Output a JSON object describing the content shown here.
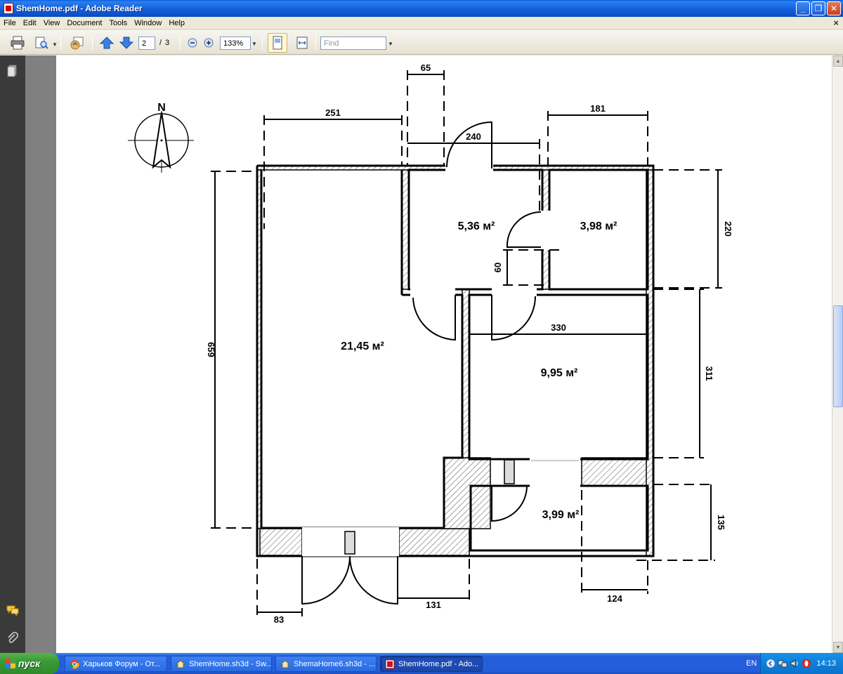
{
  "window": {
    "title": "ShemHome.pdf - Adobe Reader"
  },
  "menu": [
    "File",
    "Edit",
    "View",
    "Document",
    "Tools",
    "Window",
    "Help"
  ],
  "toolbar": {
    "current_page": "2",
    "page_separator": "/",
    "total_pages": "3",
    "zoom": "133%",
    "find_placeholder": "Find"
  },
  "floorplan": {
    "north_label": "N",
    "rooms": [
      {
        "id": "living",
        "area": "21,45 м²"
      },
      {
        "id": "small-a",
        "area": "5,36 м²"
      },
      {
        "id": "small-b",
        "area": "3,98 м²"
      },
      {
        "id": "bedroom",
        "area": "9,95 м²"
      },
      {
        "id": "bath",
        "area": "3,99 м²"
      }
    ],
    "dimensions": [
      "251",
      "65",
      "240",
      "181",
      "220",
      "60",
      "330",
      "311",
      "659",
      "135",
      "124",
      "131",
      "83"
    ]
  },
  "taskbar": {
    "start_label": "пуск",
    "tasks": [
      {
        "label": "Харьков Форум - От...",
        "icon": "chrome-icon"
      },
      {
        "label": "ShemHome.sh3d - Sw...",
        "icon": "sweethome-icon"
      },
      {
        "label": "ShemaHome6.sh3d - ...",
        "icon": "sweethome-icon"
      },
      {
        "label": "ShemHome.pdf - Ado...",
        "icon": "acrobat-icon"
      }
    ],
    "language": "EN",
    "clock": "14:13"
  }
}
